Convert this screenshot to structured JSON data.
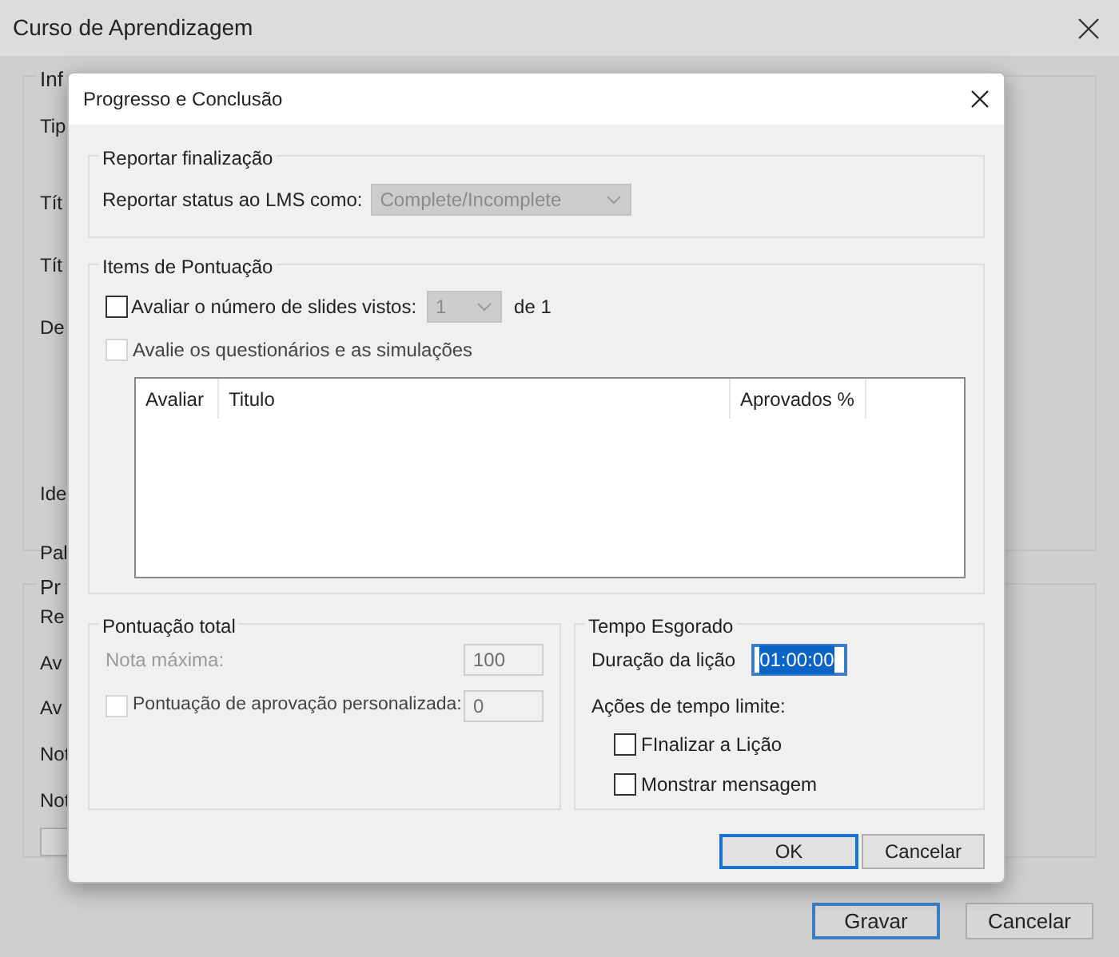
{
  "window": {
    "title": "Curso de Aprendizagem"
  },
  "background": {
    "group_1": {
      "legend": "Inf",
      "labels": [
        "Tip",
        "Tít",
        "Tít",
        "De",
        "Ide",
        "Pal"
      ]
    },
    "group_2": {
      "legend": "Pr",
      "labels": [
        "Re",
        "Av",
        "Av",
        "Not",
        "Not"
      ]
    },
    "buttons": [
      {
        "label": "Gravar",
        "default": true
      },
      {
        "label": "Cancelar",
        "default": false
      }
    ]
  },
  "dialog": {
    "title": "Progresso e Conclusão",
    "report": {
      "legend": "Reportar finalização",
      "label": "Reportar status ao LMS como:",
      "value": "Complete/Incomplete",
      "disabled": true
    },
    "scoring": {
      "legend": "Items de Pontuação",
      "slides": {
        "label": "Avaliar o número de slides vistos:",
        "checked": false,
        "disabled": false,
        "value": "1",
        "value_disabled": true,
        "suffix": "de 1"
      },
      "quizzes": {
        "label": "Avalie os questionários e as simulações",
        "checked": false,
        "disabled": true
      },
      "table": {
        "columns": [
          "Avaliar",
          "Titulo",
          "Aprovados %",
          ""
        ]
      }
    },
    "total": {
      "legend": "Pontuação total",
      "max": {
        "label": "Nota máxima:",
        "value": "100",
        "disabled": true
      },
      "custom": {
        "label": "Pontuação de aprovação personalizada:",
        "checked": false,
        "disabled": true,
        "value": "0"
      }
    },
    "time": {
      "legend": "Tempo Esgorado",
      "duration_label": "Duração da lição",
      "duration": "01:00:00",
      "duration_selected": true,
      "actions_label": "Ações de tempo limite:",
      "actions": [
        {
          "label": "FInalizar a Lição",
          "checked": false
        },
        {
          "label": "Monstrar mensagem",
          "checked": false
        }
      ]
    },
    "buttons": [
      {
        "label": "OK",
        "default": true
      },
      {
        "label": "Cancelar",
        "default": false
      }
    ]
  }
}
